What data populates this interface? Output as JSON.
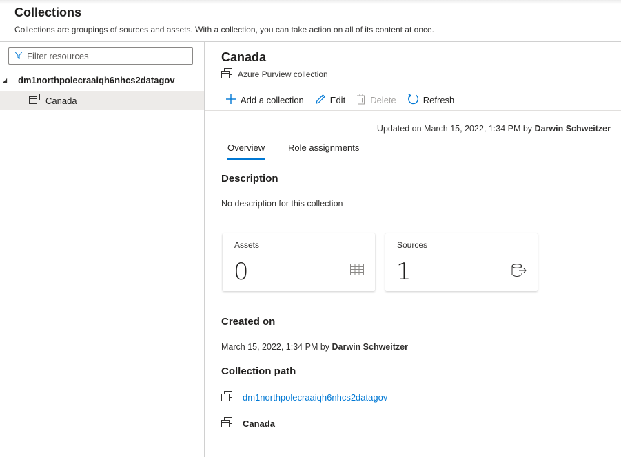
{
  "header": {
    "title": "Collections",
    "subtitle": "Collections are groupings of sources and assets. With a collection, you can take action on all of its content at once."
  },
  "sidebar": {
    "filter_placeholder": "Filter resources",
    "tree": {
      "root_label": "dm1northpolecraaiqh6nhcs2datagov",
      "children": [
        {
          "label": "Canada",
          "selected": true
        }
      ]
    }
  },
  "detail": {
    "title": "Canada",
    "type_label": "Azure Purview collection",
    "toolbar": {
      "add_label": "Add a collection",
      "edit_label": "Edit",
      "delete_label": "Delete",
      "refresh_label": "Refresh"
    },
    "updated": {
      "prefix": "Updated on March 15, 2022, 1:34 PM by",
      "user": "Darwin Schweitzer"
    },
    "tabs": [
      {
        "label": "Overview",
        "active": true
      },
      {
        "label": "Role assignments",
        "active": false
      }
    ],
    "description": {
      "heading": "Description",
      "text": "No description for this collection"
    },
    "cards": {
      "assets": {
        "label": "Assets",
        "value": "0"
      },
      "sources": {
        "label": "Sources",
        "value": "1"
      }
    },
    "created": {
      "heading": "Created on",
      "prefix": "March 15, 2022, 1:34 PM by",
      "user": "Darwin Schweitzer"
    },
    "path": {
      "heading": "Collection path",
      "items": [
        {
          "label": "dm1northpolecraaiqh6nhcs2datagov",
          "link": true
        },
        {
          "label": "Canada",
          "link": false
        }
      ]
    }
  },
  "colors": {
    "accent": "#0078d4",
    "selected_row": "#edebe9",
    "border": "#d0d0d0"
  },
  "icons": [
    "filter-icon",
    "collection-icon",
    "add-icon",
    "edit-icon",
    "delete-icon",
    "refresh-icon",
    "table-grid-icon",
    "database-export-icon"
  ]
}
